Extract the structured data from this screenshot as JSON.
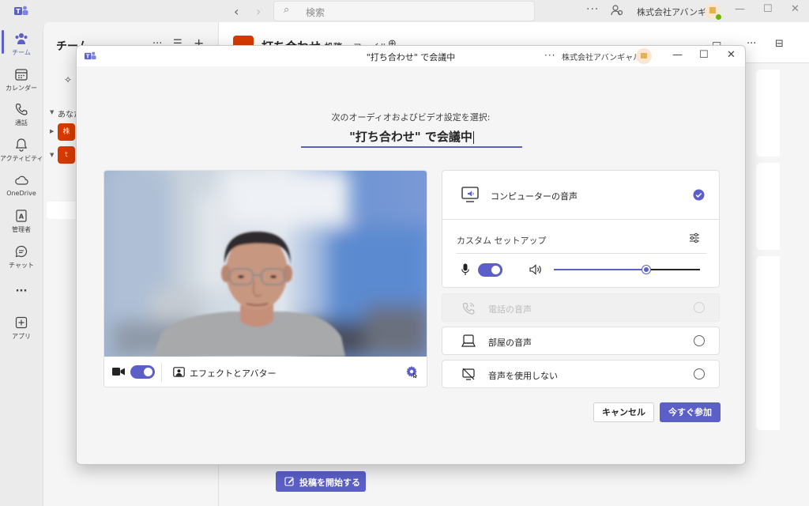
{
  "titlebar": {
    "search_placeholder": "検索",
    "org_name": "株式会社アバンギ...",
    "more": "···"
  },
  "rail": {
    "items": [
      {
        "label": "チーム",
        "icon": "teams-icon"
      },
      {
        "label": "カレンダー",
        "icon": "calendar-icon"
      },
      {
        "label": "通話",
        "icon": "phone-icon"
      },
      {
        "label": "アクティビティ",
        "icon": "bell-icon"
      },
      {
        "label": "OneDrive",
        "icon": "cloud-icon"
      },
      {
        "label": "管理者",
        "icon": "admin-icon"
      },
      {
        "label": "チャット",
        "icon": "chat-icon"
      },
      {
        "label": "···",
        "icon": "more-icon"
      },
      {
        "label": "アプリ",
        "icon": "apps-icon"
      }
    ]
  },
  "teams_panel": {
    "title": "チーム",
    "section": "あなた",
    "teams": [
      {
        "initial": "株"
      },
      {
        "initial": "t"
      }
    ]
  },
  "channel": {
    "title": "打ち合わせ",
    "tabs": [
      "投稿",
      "ファイル"
    ],
    "start_post": "投稿を開始する"
  },
  "dialog": {
    "title": "\"打ち合わせ\" で会議中",
    "org_name": "株式会社アバンギャルド",
    "more": "···",
    "choose_label": "次のオーディオおよびビデオ設定を選択:",
    "meeting_name": "\"打ち合わせ\" で会議中",
    "video": {
      "camera_on": true,
      "effects_label": "エフェクトとアバター"
    },
    "audio": {
      "computer_label": "コンピューターの音声",
      "custom_setup_label": "カスタム セットアップ",
      "mic_on": true,
      "speaker_volume": 0.63,
      "phone_label": "電話の音声",
      "room_label": "部屋の音声",
      "none_label": "音声を使用しない"
    },
    "cancel_label": "キャンセル",
    "join_label": "今すぐ参加"
  },
  "colors": {
    "accent": "#5b5fc7",
    "badge": "#d83b01"
  }
}
